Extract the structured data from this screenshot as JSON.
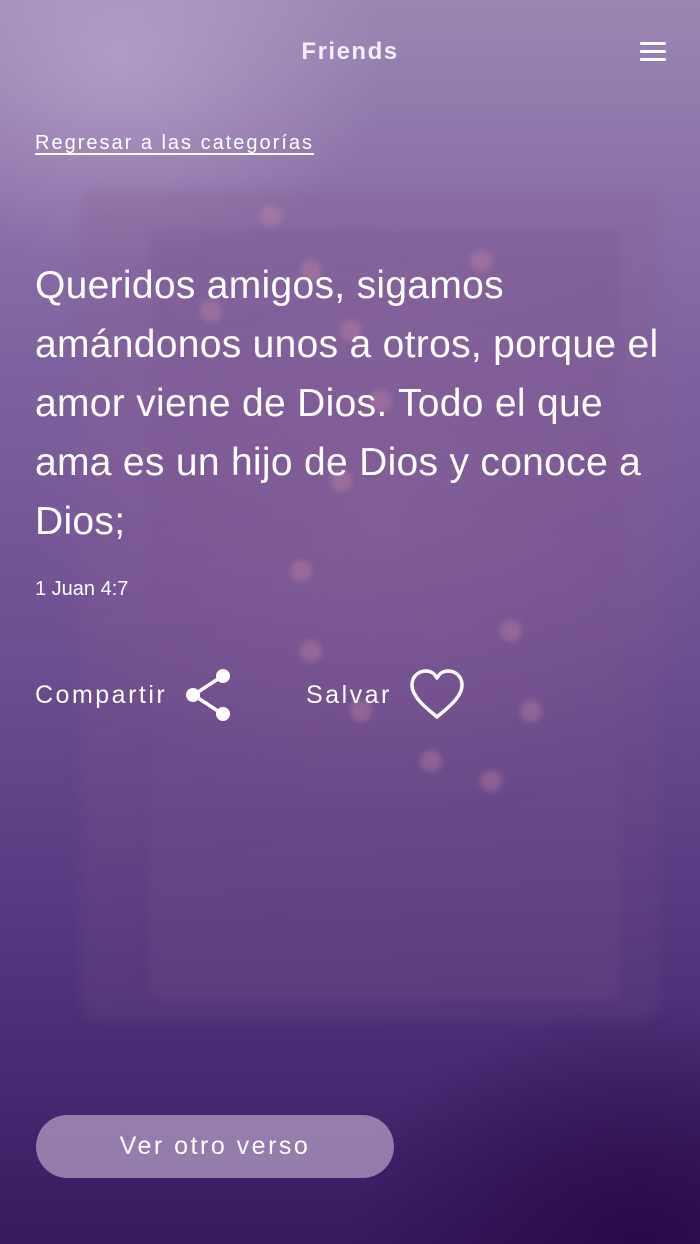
{
  "app": {
    "title": "Friends"
  },
  "nav": {
    "back_label": "Regresar a las categorías"
  },
  "verse": {
    "text": "Queridos amigos, sigamos amándonos unos a otros, porque el amor viene de Dios. Todo el que ama es un hijo de Dios y conoce a Dios;",
    "reference": "1 Juan 4:7"
  },
  "actions": {
    "share_label": "Compartir",
    "share_icon": "share-icon",
    "save_label": "Salvar",
    "save_icon": "heart-icon"
  },
  "footer": {
    "next_verse_label": "Ver otro verso"
  },
  "colors": {
    "background_top": "#9a86b2",
    "background_bottom": "#38195f",
    "button_background": "#c8b4d7",
    "text": "#ffffff"
  }
}
